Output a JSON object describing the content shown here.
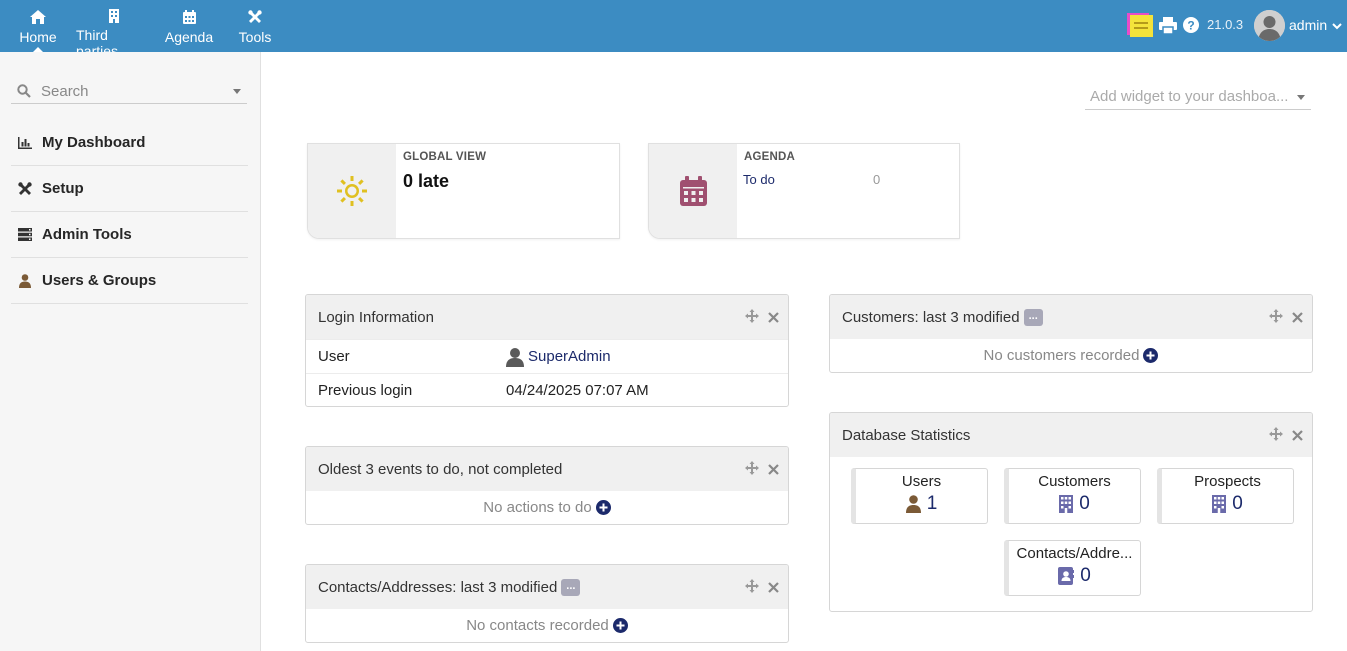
{
  "topnav": {
    "items": [
      {
        "label": "Home",
        "icon": "home-icon",
        "active": true
      },
      {
        "label": "Third parties",
        "icon": "building-icon"
      },
      {
        "label": "Agenda",
        "icon": "calendar-icon"
      },
      {
        "label": "Tools",
        "icon": "tools-icon"
      }
    ],
    "version": "21.0.3",
    "user": "admin"
  },
  "sidebar": {
    "search_placeholder": "Search",
    "items": [
      {
        "label": "My Dashboard",
        "icon": "chart-icon"
      },
      {
        "label": "Setup",
        "icon": "tools-icon"
      },
      {
        "label": "Admin Tools",
        "icon": "server-icon"
      },
      {
        "label": "Users & Groups",
        "icon": "user-icon"
      }
    ]
  },
  "main": {
    "widget_select_placeholder": "Add widget to your dashboa...",
    "global_view": {
      "title": "GLOBAL VIEW",
      "value": "0 late"
    },
    "agenda": {
      "title": "AGENDA",
      "row_label": "To do",
      "row_value": "0"
    },
    "login_info": {
      "title": "Login Information",
      "user_label": "User",
      "user_value": "SuperAdmin",
      "prev_label": "Previous login",
      "prev_value": "04/24/2025 07:07 AM"
    },
    "events": {
      "title": "Oldest 3 events to do, not completed",
      "empty": "No actions to do"
    },
    "contacts": {
      "title": "Contacts/Addresses: last 3 modified",
      "badge": "...",
      "empty": "No contacts recorded"
    },
    "customers": {
      "title": "Customers: last 3 modified",
      "badge": "...",
      "empty": "No customers recorded"
    },
    "stats": {
      "title": "Database Statistics",
      "items": [
        {
          "label": "Users",
          "value": "1",
          "icon": "user-icon"
        },
        {
          "label": "Customers",
          "value": "0",
          "icon": "building-icon"
        },
        {
          "label": "Prospects",
          "value": "0",
          "icon": "building-icon"
        },
        {
          "label": "Contacts/Addre...",
          "value": "0",
          "icon": "address-book-icon"
        }
      ]
    }
  },
  "colors": {
    "topbar": "#3c8cc2",
    "link": "#1c2a6b",
    "sun": "#e0c020",
    "calendar": "#a05070"
  }
}
